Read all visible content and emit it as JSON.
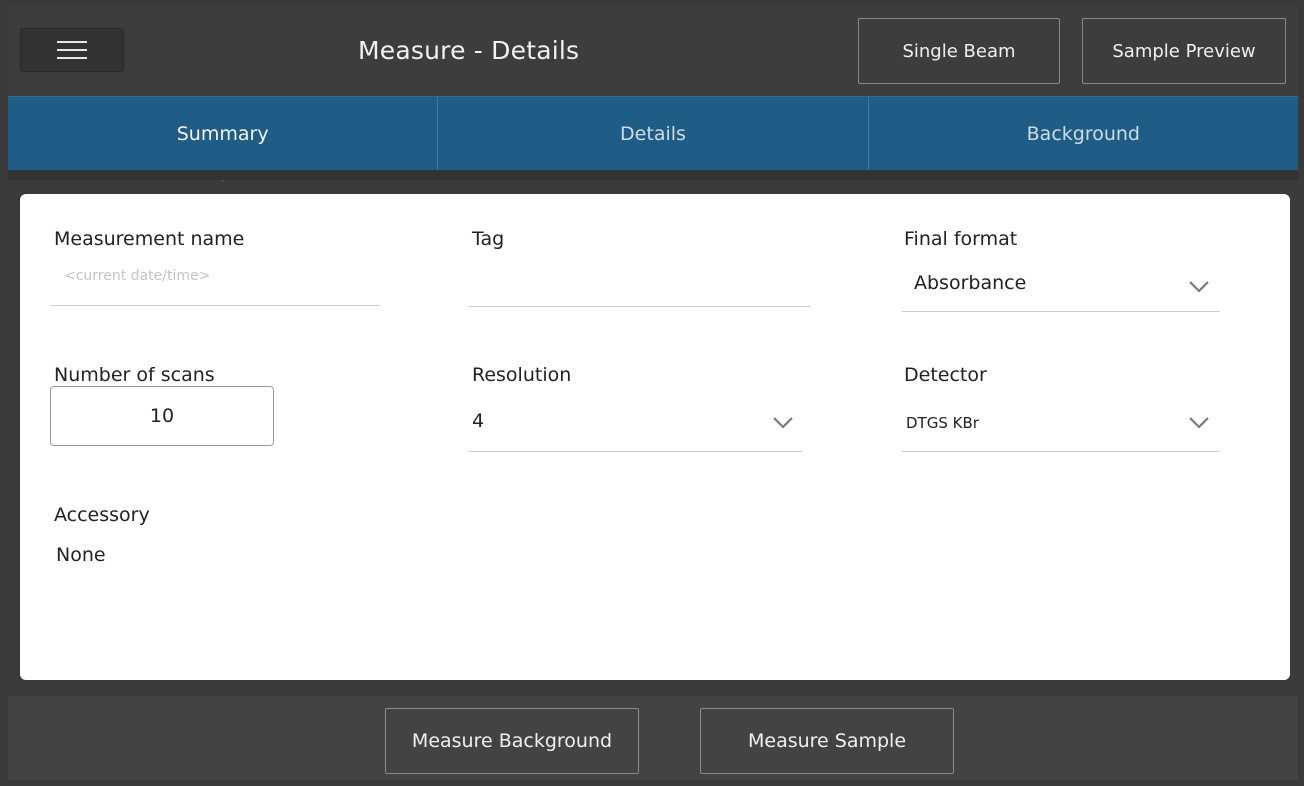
{
  "header": {
    "title": "Measure - Details",
    "single_beam_label": "Single Beam",
    "sample_preview_label": "Sample Preview"
  },
  "tabs": [
    {
      "label": "Summary",
      "active": true
    },
    {
      "label": "Details",
      "active": false
    },
    {
      "label": "Background",
      "active": false
    }
  ],
  "form": {
    "measurement_name": {
      "label": "Measurement name",
      "placeholder": "<current date/time>",
      "value": ""
    },
    "tag": {
      "label": "Tag",
      "value": ""
    },
    "final_format": {
      "label": "Final format",
      "value": "Absorbance"
    },
    "number_of_scans": {
      "label": "Number of scans",
      "value": "10"
    },
    "resolution": {
      "label": "Resolution",
      "value": "4"
    },
    "detector": {
      "label": "Detector",
      "value": "DTGS KBr"
    },
    "accessory": {
      "label": "Accessory",
      "value": "None"
    }
  },
  "footer": {
    "measure_background_label": "Measure Background",
    "measure_sample_label": "Measure Sample"
  },
  "icons": {
    "menu": "hamburger-icon",
    "dropdown": "chevron-down-icon"
  },
  "colors": {
    "tab_bar": "#1f5d86",
    "header_bg": "#3d3d3d",
    "panel_bg": "#ffffff"
  }
}
